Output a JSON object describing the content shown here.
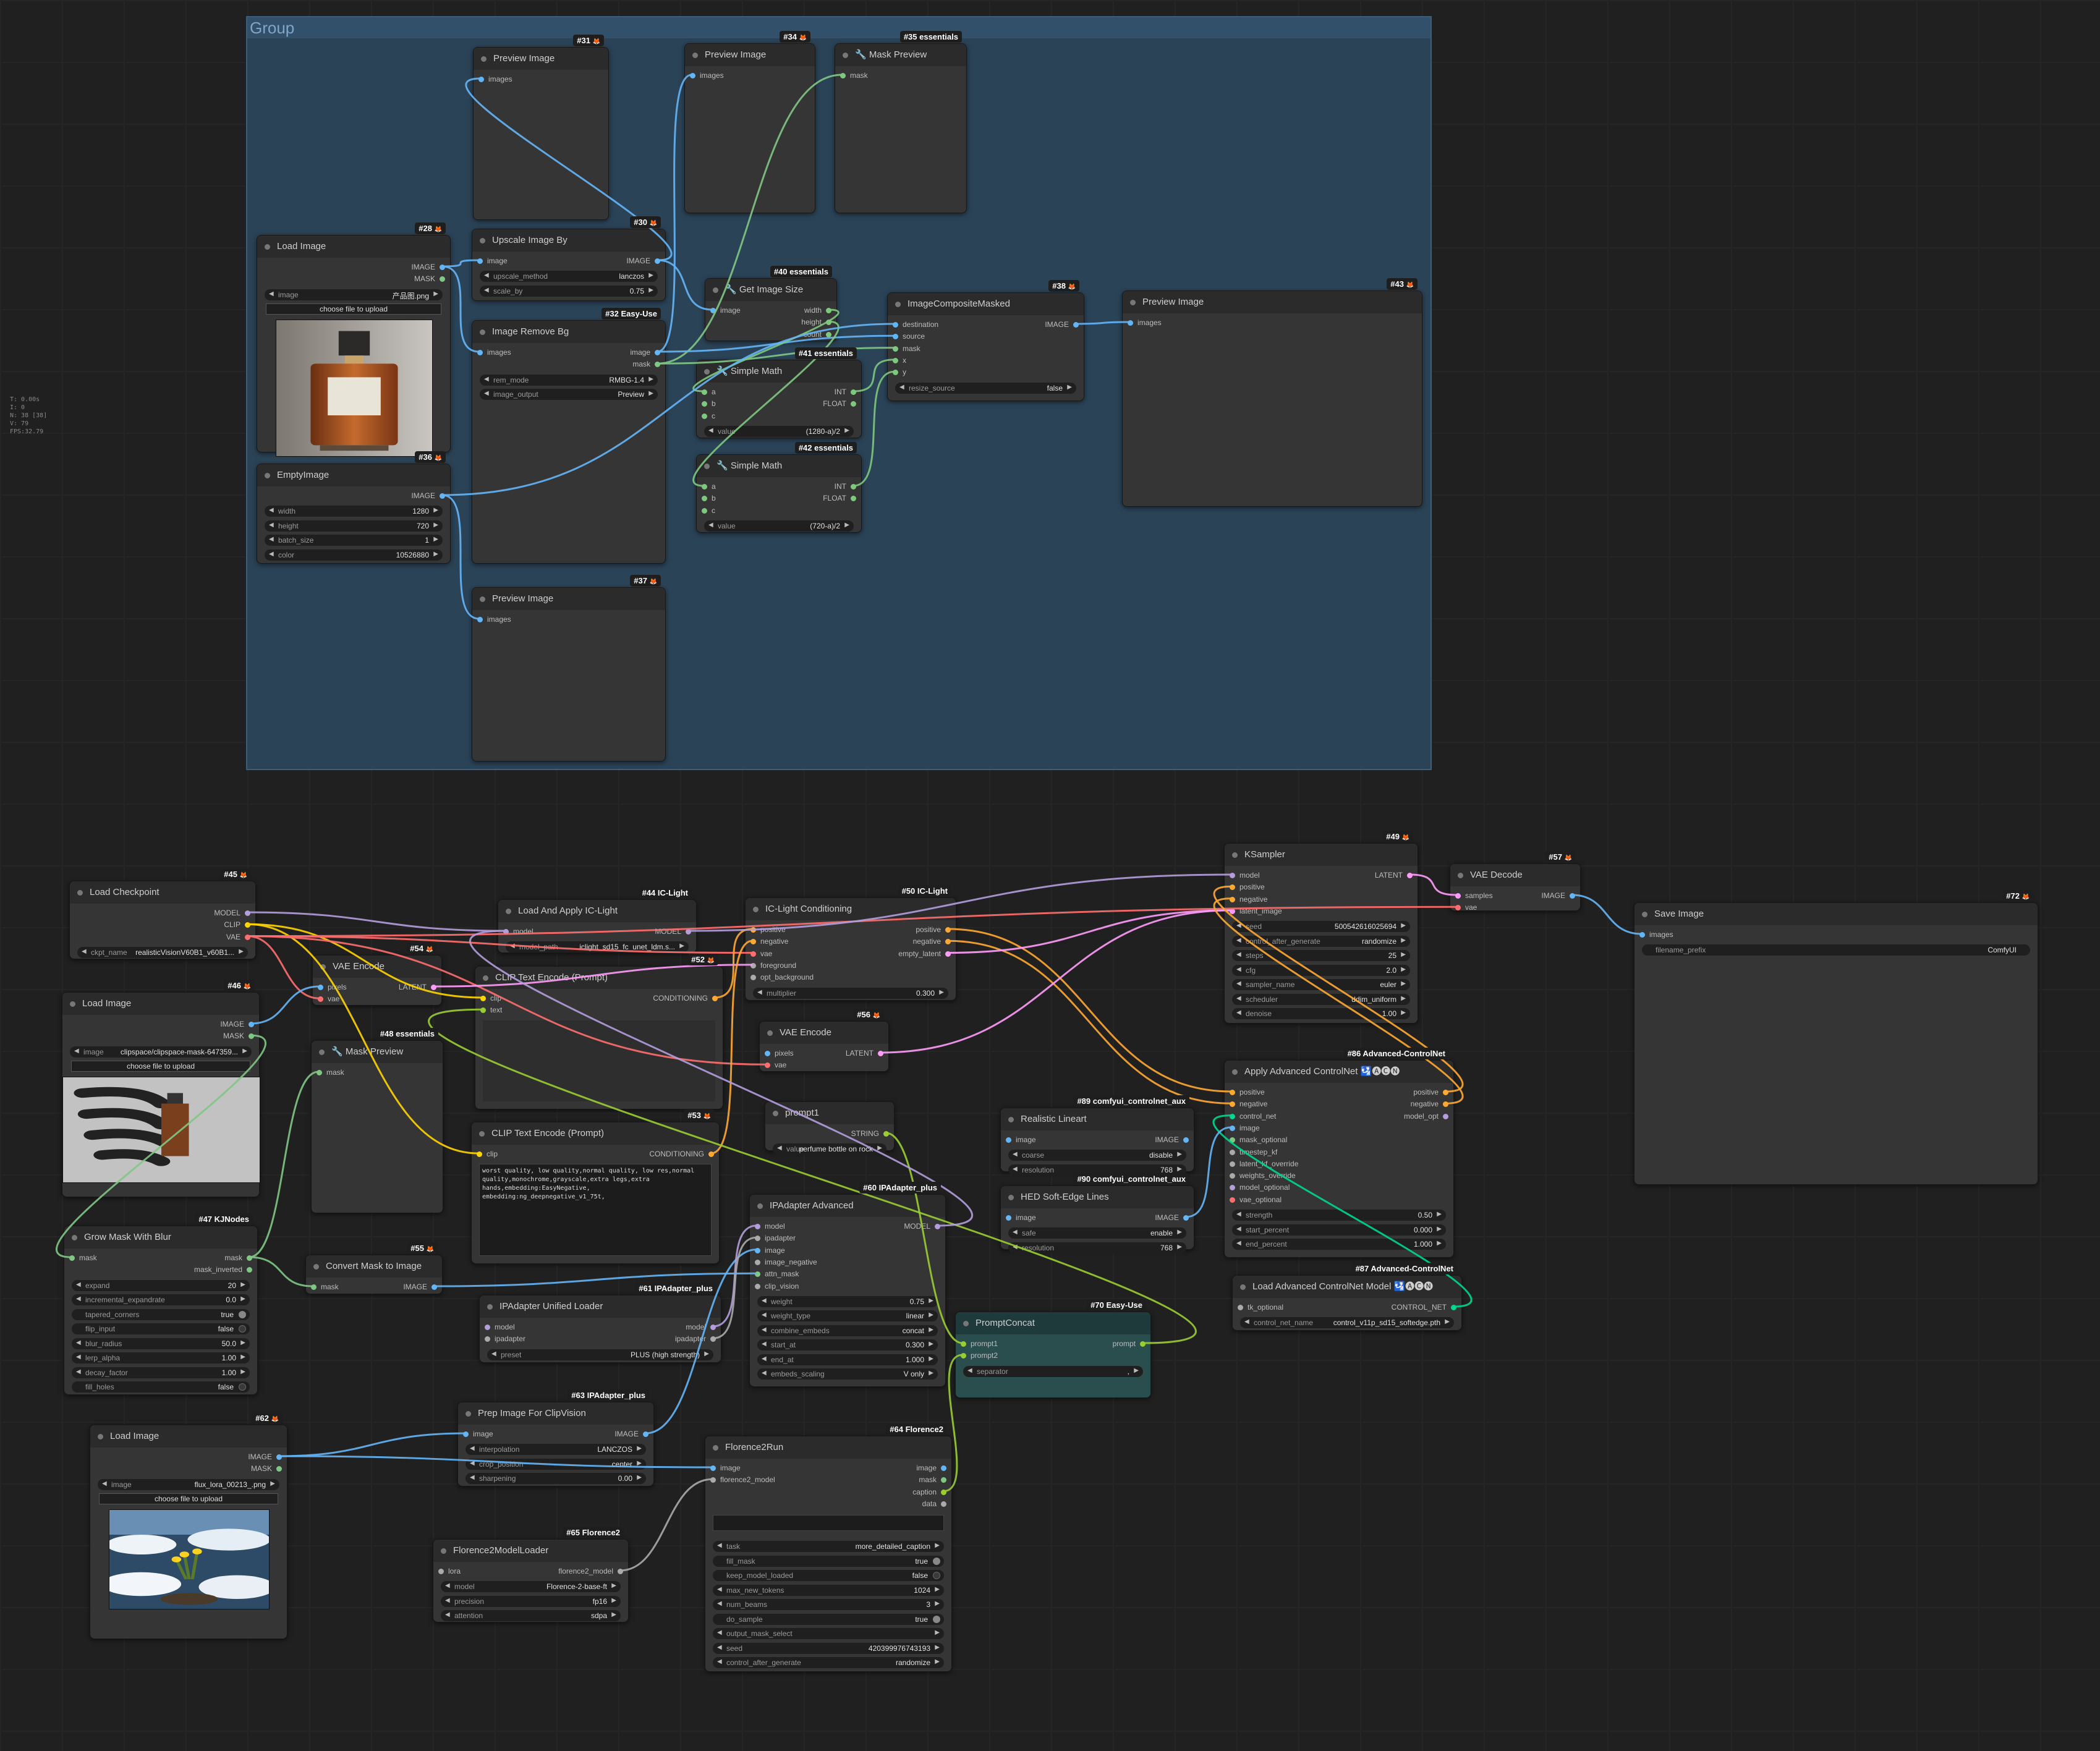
{
  "group": {
    "title": "Group"
  },
  "stats": [
    "T: 0.00s",
    "I: 0",
    "N: 38 [38]",
    "V: 79",
    "FPS:32.79"
  ],
  "nodes": {
    "n31": {
      "id": "#31",
      "title": "Preview Image",
      "inputs": [
        "images"
      ]
    },
    "n34": {
      "id": "#34",
      "title": "Preview Image",
      "inputs": [
        "images"
      ]
    },
    "n35": {
      "id": "#35 essentials",
      "title": "🔧 Mask Preview",
      "inputs": [
        "mask"
      ]
    },
    "n28": {
      "id": "#28",
      "title": "Load Image",
      "outputs": [
        "IMAGE",
        "MASK"
      ],
      "widgets": [
        {
          "label": "image",
          "value": "产品图.png"
        }
      ],
      "upload": "choose file to upload"
    },
    "n30": {
      "id": "#30",
      "title": "Upscale Image By",
      "inputs": [
        "image"
      ],
      "outputs": [
        "IMAGE"
      ],
      "widgets": [
        {
          "label": "upscale_method",
          "value": "lanczos"
        },
        {
          "label": "scale_by",
          "value": "0.75"
        }
      ]
    },
    "n32": {
      "id": "#32 Easy-Use",
      "title": "Image Remove Bg",
      "inputs": [
        "images"
      ],
      "outputs": [
        "image",
        "mask"
      ],
      "widgets": [
        {
          "label": "rem_mode",
          "value": "RMBG-1.4"
        },
        {
          "label": "image_output",
          "value": "Preview"
        }
      ]
    },
    "n40": {
      "id": "#40 essentials",
      "title": "🔧 Get Image Size",
      "inputs": [
        "image"
      ],
      "outputs": [
        "width",
        "height",
        "count"
      ]
    },
    "n41": {
      "id": "#41 essentials",
      "title": "🔧 Simple Math",
      "inputs": [
        "a",
        "b",
        "c"
      ],
      "outputs": [
        "INT",
        "FLOAT"
      ],
      "widgets": [
        {
          "label": "value",
          "value": "(1280-a)/2"
        }
      ]
    },
    "n42": {
      "id": "#42 essentials",
      "title": "🔧 Simple Math",
      "inputs": [
        "a",
        "b",
        "c"
      ],
      "outputs": [
        "INT",
        "FLOAT"
      ],
      "widgets": [
        {
          "label": "value",
          "value": "(720-a)/2"
        }
      ]
    },
    "n38": {
      "id": "#38",
      "title": "ImageCompositeMasked",
      "inputs": [
        "destination",
        "source",
        "mask",
        "x",
        "y"
      ],
      "outputs": [
        "IMAGE"
      ],
      "widgets": [
        {
          "label": "resize_source",
          "value": "false"
        }
      ]
    },
    "n43": {
      "id": "#43",
      "title": "Preview Image",
      "inputs": [
        "images"
      ]
    },
    "n36": {
      "id": "#36",
      "title": "EmptyImage",
      "outputs": [
        "IMAGE"
      ],
      "widgets": [
        {
          "label": "width",
          "value": "1280"
        },
        {
          "label": "height",
          "value": "720"
        },
        {
          "label": "batch_size",
          "value": "1"
        },
        {
          "label": "color",
          "value": "10526880"
        }
      ]
    },
    "n37": {
      "id": "#37",
      "title": "Preview Image",
      "inputs": [
        "images"
      ]
    },
    "n45": {
      "id": "#45",
      "title": "Load Checkpoint",
      "outputs": [
        "MODEL",
        "CLIP",
        "VAE"
      ],
      "widgets": [
        {
          "label": "ckpt_name",
          "value": "realisticVisionV60B1_v60B1..."
        }
      ]
    },
    "n44": {
      "id": "#44 IC-Light",
      "title": "Load And Apply IC-Light",
      "inputs": [
        "model"
      ],
      "outputs": [
        "MODEL"
      ],
      "widgets": [
        {
          "label": "model_path",
          "value": "iclight_sd15_fc_unet_ldm.s..."
        }
      ]
    },
    "n50": {
      "id": "#50 IC-Light",
      "title": "IC-Light Conditioning",
      "inputs": [
        "positive",
        "negative",
        "vae",
        "foreground",
        "opt_background"
      ],
      "outputs": [
        "positive",
        "negative",
        "empty_latent"
      ],
      "widgets": [
        {
          "label": "multiplier",
          "value": "0.300"
        }
      ]
    },
    "n49": {
      "id": "#49",
      "title": "KSampler",
      "inputs": [
        "model",
        "positive",
        "negative",
        "latent_image"
      ],
      "outputs": [
        "LATENT"
      ],
      "widgets": [
        {
          "label": "seed",
          "value": "500542616025694"
        },
        {
          "label": "control_after_generate",
          "value": "randomize"
        },
        {
          "label": "steps",
          "value": "25"
        },
        {
          "label": "cfg",
          "value": "2.0"
        },
        {
          "label": "sampler_name",
          "value": "euler"
        },
        {
          "label": "scheduler",
          "value": "ddim_uniform"
        },
        {
          "label": "denoise",
          "value": "1.00"
        }
      ]
    },
    "n57": {
      "id": "#57",
      "title": "VAE Decode",
      "inputs": [
        "samples",
        "vae"
      ],
      "outputs": [
        "IMAGE"
      ]
    },
    "n72": {
      "id": "#72",
      "title": "Save Image",
      "inputs": [
        "images"
      ],
      "widgets": [
        {
          "label": "filename_prefix",
          "value": "ComfyUI"
        }
      ]
    },
    "n54": {
      "id": "#54",
      "title": "VAE Encode",
      "inputs": [
        "pixels",
        "vae"
      ],
      "outputs": [
        "LATENT"
      ]
    },
    "n52": {
      "id": "#52",
      "title": "CLIP Text Encode (Prompt)",
      "inputs": [
        "clip",
        "text"
      ],
      "outputs": [
        "CONDITIONING"
      ]
    },
    "n46": {
      "id": "#46",
      "title": "Load Image",
      "outputs": [
        "IMAGE",
        "MASK"
      ],
      "widgets": [
        {
          "label": "image",
          "value": "clipspace/clipspace-mask-647359..."
        }
      ],
      "upload": "choose file to upload"
    },
    "n48": {
      "id": "#48 essentials",
      "title": "🔧 Mask Preview",
      "inputs": [
        "mask"
      ]
    },
    "n56": {
      "id": "#56",
      "title": "VAE Encode",
      "inputs": [
        "pixels",
        "vae"
      ],
      "outputs": [
        "LATENT"
      ]
    },
    "n53": {
      "id": "#53",
      "title": "CLIP Text Encode (Prompt)",
      "inputs": [
        "clip"
      ],
      "outputs": [
        "CONDITIONING"
      ],
      "text": "worst quality, low quality,normal quality, low res,normal quality,monochrome,grayscale,extra legs,extra hands,embedding:EasyNegative, embedding:ng_deepnegative_v1_75t,"
    },
    "prompt1": {
      "title": "prompt1",
      "outputs": [
        "STRING"
      ],
      "widgets": [
        {
          "label": "value",
          "value": "perfume bottle on rock"
        }
      ]
    },
    "n89": {
      "id": "#89 comfyui_controlnet_aux",
      "title": "Realistic Lineart",
      "inputs": [
        "image"
      ],
      "outputs": [
        "IMAGE"
      ],
      "widgets": [
        {
          "label": "coarse",
          "value": "disable"
        },
        {
          "label": "resolution",
          "value": "768"
        }
      ]
    },
    "n90": {
      "id": "#90 comfyui_controlnet_aux",
      "title": "HED Soft-Edge Lines",
      "inputs": [
        "image"
      ],
      "outputs": [
        "IMAGE"
      ],
      "widgets": [
        {
          "label": "safe",
          "value": "enable"
        },
        {
          "label": "resolution",
          "value": "768"
        }
      ]
    },
    "n86": {
      "id": "#86 Advanced-ControlNet",
      "title": "Apply Advanced ControlNet 🛂🅐🅒🅝",
      "inputs": [
        "positive",
        "negative",
        "control_net",
        "image",
        "mask_optional",
        "timestep_kf",
        "latent_kf_override",
        "weights_override",
        "model_optional",
        "vae_optional"
      ],
      "outputs": [
        "positive",
        "negative",
        "model_opt"
      ],
      "widgets": [
        {
          "label": "strength",
          "value": "0.50"
        },
        {
          "label": "start_percent",
          "value": "0.000"
        },
        {
          "label": "end_percent",
          "value": "1.000"
        }
      ]
    },
    "n87": {
      "id": "#87 Advanced-ControlNet",
      "title": "Load Advanced ControlNet Model 🛂🅐🅒🅝",
      "inputs": [
        "tk_optional"
      ],
      "outputs": [
        "CONTROL_NET"
      ],
      "widgets": [
        {
          "label": "control_net_name",
          "value": "control_v11p_sd15_softedge.pth"
        }
      ]
    },
    "n47": {
      "id": "#47 KJNodes",
      "title": "Grow Mask With Blur",
      "inputs": [
        "mask"
      ],
      "outputs": [
        "mask",
        "mask_inverted"
      ],
      "widgets": [
        {
          "label": "expand",
          "value": "20"
        },
        {
          "label": "incremental_expandrate",
          "value": "0.0"
        },
        {
          "label": "tapered_corners",
          "value": "true"
        },
        {
          "label": "flip_input",
          "value": "false"
        },
        {
          "label": "blur_radius",
          "value": "50.0"
        },
        {
          "label": "lerp_alpha",
          "value": "1.00"
        },
        {
          "label": "decay_factor",
          "value": "1.00"
        },
        {
          "label": "fill_holes",
          "value": "false"
        }
      ]
    },
    "n55": {
      "id": "#55",
      "title": "Convert Mask to Image",
      "inputs": [
        "mask"
      ],
      "outputs": [
        "IMAGE"
      ]
    },
    "n61": {
      "id": "#61 IPAdapter_plus",
      "title": "IPAdapter Unified Loader",
      "inputs": [
        "model",
        "ipadapter"
      ],
      "outputs": [
        "model",
        "ipadapter"
      ],
      "widgets": [
        {
          "label": "preset",
          "value": "PLUS (high strength)"
        }
      ]
    },
    "n60": {
      "id": "#60 IPAdapter_plus",
      "title": "IPAdapter Advanced",
      "inputs": [
        "model",
        "ipadapter",
        "image",
        "image_negative",
        "attn_mask",
        "clip_vision"
      ],
      "outputs": [
        "MODEL"
      ],
      "widgets": [
        {
          "label": "weight",
          "value": "0.75"
        },
        {
          "label": "weight_type",
          "value": "linear"
        },
        {
          "label": "combine_embeds",
          "value": "concat"
        },
        {
          "label": "start_at",
          "value": "0.300"
        },
        {
          "label": "end_at",
          "value": "1.000"
        },
        {
          "label": "embeds_scaling",
          "value": "V only"
        }
      ]
    },
    "n70": {
      "id": "#70 Easy-Use",
      "title": "PromptConcat",
      "inputs": [
        "prompt1",
        "prompt2"
      ],
      "outputs": [
        "prompt"
      ],
      "widgets": [
        {
          "label": "separator",
          "value": ","
        }
      ]
    },
    "n63": {
      "id": "#63 IPAdapter_plus",
      "title": "Prep Image For ClipVision",
      "inputs": [
        "image"
      ],
      "outputs": [
        "IMAGE"
      ],
      "widgets": [
        {
          "label": "interpolation",
          "value": "LANCZOS"
        },
        {
          "label": "crop_position",
          "value": "center"
        },
        {
          "label": "sharpening",
          "value": "0.00"
        }
      ]
    },
    "n62": {
      "id": "#62",
      "title": "Load Image",
      "outputs": [
        "IMAGE",
        "MASK"
      ],
      "widgets": [
        {
          "label": "image",
          "value": "flux_lora_00213_.png"
        }
      ],
      "upload": "choose file to upload"
    },
    "n64": {
      "id": "#64 Florence2",
      "title": "Florence2Run",
      "inputs": [
        "image",
        "florence2_model"
      ],
      "outputs": [
        "image",
        "mask",
        "caption",
        "data"
      ],
      "widgets": [
        {
          "label": "task",
          "value": "more_detailed_caption"
        },
        {
          "label": "fill_mask",
          "value": "true"
        },
        {
          "label": "keep_model_loaded",
          "value": "false"
        },
        {
          "label": "max_new_tokens",
          "value": "1024"
        },
        {
          "label": "num_beams",
          "value": "3"
        },
        {
          "label": "do_sample",
          "value": "true"
        },
        {
          "label": "output_mask_select",
          "value": ""
        },
        {
          "label": "seed",
          "value": "420399976743193"
        },
        {
          "label": "control_after_generate",
          "value": "randomize"
        }
      ]
    },
    "n65": {
      "id": "#65 Florence2",
      "title": "Florence2ModelLoader",
      "inputs": [
        "lora"
      ],
      "outputs": [
        "florence2_model"
      ],
      "widgets": [
        {
          "label": "model",
          "value": "Florence-2-base-ft"
        },
        {
          "label": "precision",
          "value": "fp16"
        },
        {
          "label": "attention",
          "value": "sdpa"
        }
      ]
    }
  },
  "colors": {
    "IMAGE": "#64b5f6",
    "MASK": "#81c784",
    "MODEL": "#b39ddb",
    "CLIP": "#ffd500",
    "VAE": "#ff6e6e",
    "LATENT": "#ff9cf9",
    "CONDITIONING": "#ffa931",
    "INT": "#7ec87e",
    "STRING": "#9acd32",
    "CONTROL_NET": "#00d78d",
    "OTHER": "#aaaaaa"
  }
}
